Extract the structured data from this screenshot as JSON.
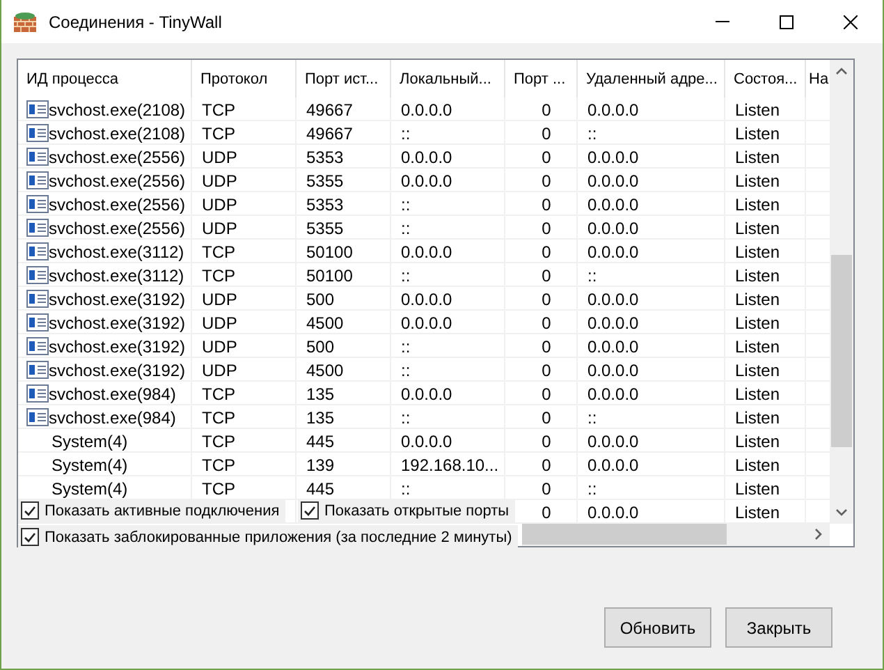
{
  "window": {
    "title": "Соединения - TinyWall"
  },
  "table": {
    "columns": [
      "ИД процесса",
      "Протокол",
      "Порт ист...",
      "Локальный...",
      "Порт ...",
      "Удаленный адре...",
      "Состоя...",
      "На"
    ],
    "rows": [
      {
        "kind": "service",
        "process": "svchost.exe(2108)",
        "protocol": "TCP",
        "local_port": "49667",
        "local_address": "0.0.0.0",
        "remote_port": "0",
        "remote_address": "0.0.0.0",
        "state": "Listen"
      },
      {
        "kind": "service",
        "process": "svchost.exe(2108)",
        "protocol": "TCP",
        "local_port": "49667",
        "local_address": "::",
        "remote_port": "0",
        "remote_address": "::",
        "state": "Listen"
      },
      {
        "kind": "service",
        "process": "svchost.exe(2556)",
        "protocol": "UDP",
        "local_port": "5353",
        "local_address": "0.0.0.0",
        "remote_port": "0",
        "remote_address": "0.0.0.0",
        "state": "Listen"
      },
      {
        "kind": "service",
        "process": "svchost.exe(2556)",
        "protocol": "UDP",
        "local_port": "5355",
        "local_address": "0.0.0.0",
        "remote_port": "0",
        "remote_address": "0.0.0.0",
        "state": "Listen"
      },
      {
        "kind": "service",
        "process": "svchost.exe(2556)",
        "protocol": "UDP",
        "local_port": "5353",
        "local_address": "::",
        "remote_port": "0",
        "remote_address": "0.0.0.0",
        "state": "Listen"
      },
      {
        "kind": "service",
        "process": "svchost.exe(2556)",
        "protocol": "UDP",
        "local_port": "5355",
        "local_address": "::",
        "remote_port": "0",
        "remote_address": "0.0.0.0",
        "state": "Listen"
      },
      {
        "kind": "service",
        "process": "svchost.exe(3112)",
        "protocol": "TCP",
        "local_port": "50100",
        "local_address": "0.0.0.0",
        "remote_port": "0",
        "remote_address": "0.0.0.0",
        "state": "Listen"
      },
      {
        "kind": "service",
        "process": "svchost.exe(3112)",
        "protocol": "TCP",
        "local_port": "50100",
        "local_address": "::",
        "remote_port": "0",
        "remote_address": "::",
        "state": "Listen"
      },
      {
        "kind": "service",
        "process": "svchost.exe(3192)",
        "protocol": "UDP",
        "local_port": "500",
        "local_address": "0.0.0.0",
        "remote_port": "0",
        "remote_address": "0.0.0.0",
        "state": "Listen"
      },
      {
        "kind": "service",
        "process": "svchost.exe(3192)",
        "protocol": "UDP",
        "local_port": "4500",
        "local_address": "0.0.0.0",
        "remote_port": "0",
        "remote_address": "0.0.0.0",
        "state": "Listen"
      },
      {
        "kind": "service",
        "process": "svchost.exe(3192)",
        "protocol": "UDP",
        "local_port": "500",
        "local_address": "::",
        "remote_port": "0",
        "remote_address": "0.0.0.0",
        "state": "Listen"
      },
      {
        "kind": "service",
        "process": "svchost.exe(3192)",
        "protocol": "UDP",
        "local_port": "4500",
        "local_address": "::",
        "remote_port": "0",
        "remote_address": "0.0.0.0",
        "state": "Listen"
      },
      {
        "kind": "service",
        "process": "svchost.exe(984)",
        "protocol": "TCP",
        "local_port": "135",
        "local_address": "0.0.0.0",
        "remote_port": "0",
        "remote_address": "0.0.0.0",
        "state": "Listen"
      },
      {
        "kind": "service",
        "process": "svchost.exe(984)",
        "protocol": "TCP",
        "local_port": "135",
        "local_address": "::",
        "remote_port": "0",
        "remote_address": "::",
        "state": "Listen"
      },
      {
        "kind": "system",
        "process": "System(4)",
        "protocol": "TCP",
        "local_port": "445",
        "local_address": "0.0.0.0",
        "remote_port": "0",
        "remote_address": "0.0.0.0",
        "state": "Listen"
      },
      {
        "kind": "system",
        "process": "System(4)",
        "protocol": "TCP",
        "local_port": "139",
        "local_address": "192.168.10...",
        "remote_port": "0",
        "remote_address": "0.0.0.0",
        "state": "Listen"
      },
      {
        "kind": "system",
        "process": "System(4)",
        "protocol": "TCP",
        "local_port": "445",
        "local_address": "::",
        "remote_port": "0",
        "remote_address": "::",
        "state": "Listen"
      },
      {
        "kind": "hidden",
        "remote_port": "0",
        "remote_address": "0.0.0.0",
        "state": "Listen"
      }
    ]
  },
  "options": [
    {
      "label": "Показать активные подключения",
      "checked": true
    },
    {
      "label": "Показать открытые порты",
      "checked": true
    },
    {
      "label": "Показать заблокированные приложения (за последние 2 минуты)",
      "checked": true
    }
  ],
  "buttons": [
    "Обновить",
    "Закрыть"
  ]
}
